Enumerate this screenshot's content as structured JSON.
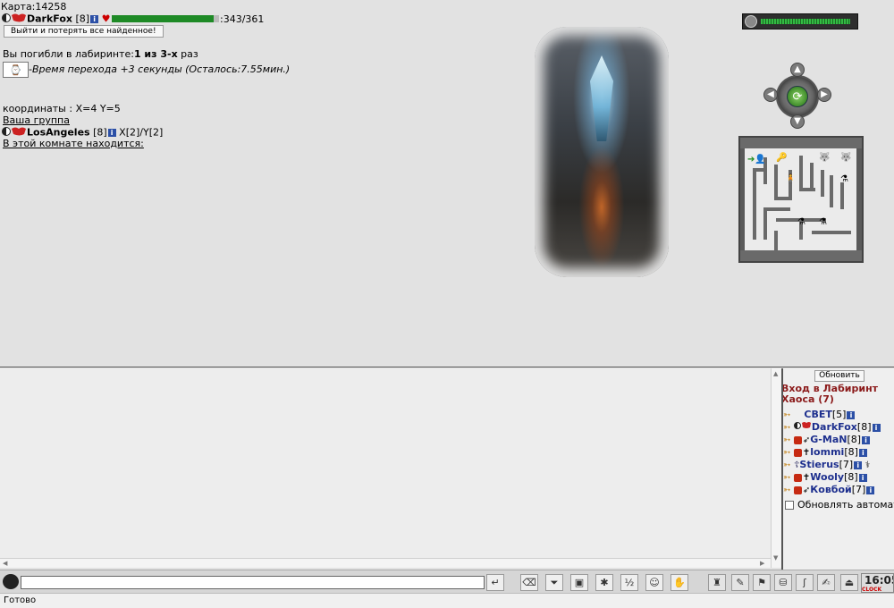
{
  "map": {
    "label": "Карта:",
    "number": "14258"
  },
  "player": {
    "name": "DarkFox",
    "level": "[8]",
    "hp_text": ":343/361",
    "hp_fraction": 0.953
  },
  "exit_button": "Выйти и потерять все найденное!",
  "death_msg": {
    "prefix": "Вы погибли в лабиринте:",
    "count": "1 из 3-х",
    "suffix": " раз"
  },
  "transit_msg": "-Время перехода +3 секунды (Осталось:7.55мин.)",
  "coords": "координаты : X=4 Y=5",
  "group": {
    "label": "Ваша группа",
    "member": {
      "name": "LosAngeles",
      "level": "[8]",
      "pos": "X[2]/Y[2]"
    }
  },
  "room_label": "В этой комнате находится:",
  "timer_fraction": 0.93,
  "who_panel": {
    "refresh_label": "Обновить",
    "title": "Вход в Лабиринт Хаоса (7)",
    "players": [
      {
        "name": "СВЕТ",
        "level": "[5]",
        "icon": "align-light-icon"
      },
      {
        "name": "DarkFox",
        "level": "[8]",
        "icon": "align-dark-icon"
      },
      {
        "name": "G-MaN",
        "level": "[8]",
        "icon": "clan-icon"
      },
      {
        "name": "lommi",
        "level": "[8]",
        "icon": "clan-icon"
      },
      {
        "name": "Stierus",
        "level": "[7]",
        "icon": "cross-icon"
      },
      {
        "name": "Wooly",
        "level": "[8]",
        "icon": "clan-icon"
      },
      {
        "name": "Ковбой",
        "level": "[7]",
        "icon": "clan-icon"
      }
    ],
    "auto_update_label": "Обновлять автомат"
  },
  "clock": {
    "time": "16:05",
    "label": "CLOCK"
  },
  "status_text": "Готово",
  "colors": {
    "hp": "#1e8a26",
    "who_title": "#8b1a1a",
    "nick": "#1d2f8e"
  }
}
